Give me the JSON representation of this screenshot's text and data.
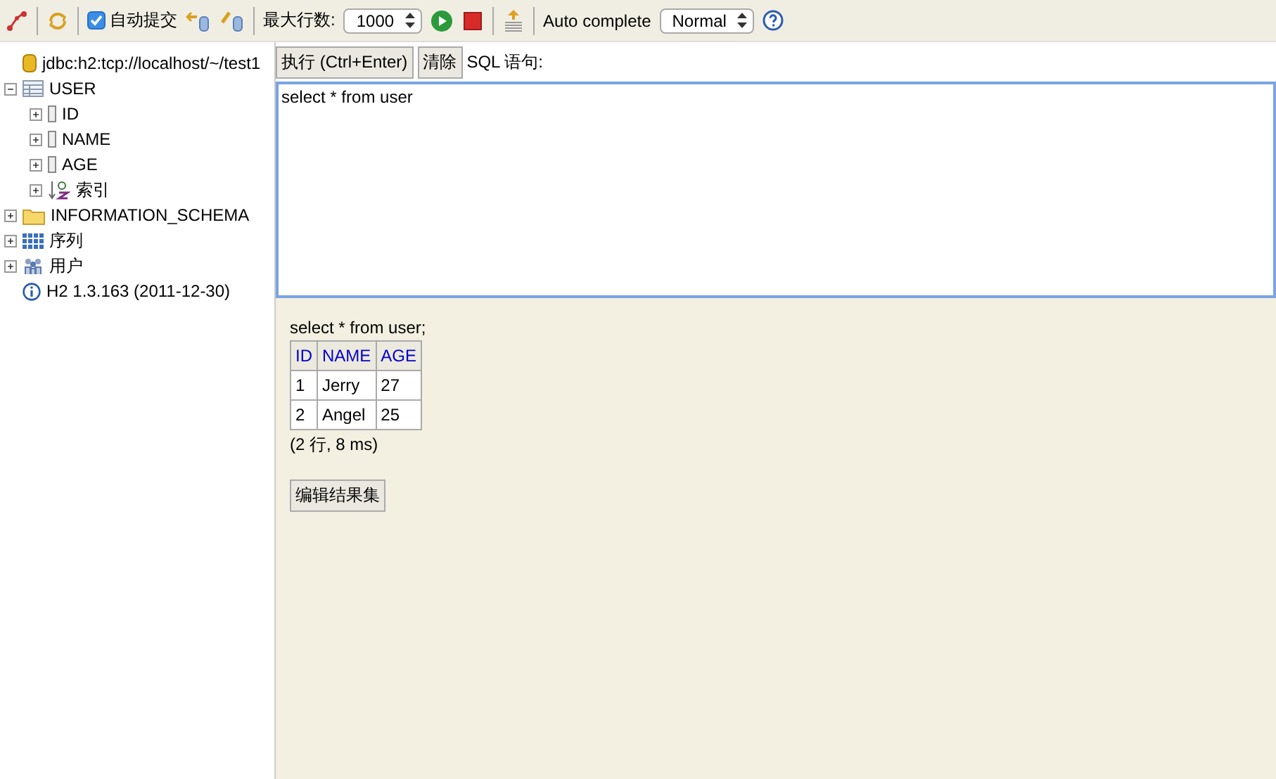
{
  "toolbar": {
    "autocommit": {
      "label": "自动提交",
      "checked": true
    },
    "max_rows": {
      "label": "最大行数:",
      "value": "1000"
    },
    "autocomplete": {
      "label": "Auto complete",
      "value": "Normal"
    }
  },
  "tree": [
    {
      "kind": "database",
      "label": "jdbc:h2:tcp://localhost/~/test1"
    },
    {
      "kind": "table",
      "label": "USER",
      "expanded": true,
      "children": [
        {
          "kind": "column",
          "label": "ID",
          "expanded": false
        },
        {
          "kind": "column",
          "label": "NAME",
          "expanded": false
        },
        {
          "kind": "column",
          "label": "AGE",
          "expanded": false
        },
        {
          "kind": "index",
          "label": "索引",
          "expanded": false
        }
      ]
    },
    {
      "kind": "folder",
      "label": "INFORMATION_SCHEMA",
      "expanded": false
    },
    {
      "kind": "sequence",
      "label": "序列",
      "expanded": false
    },
    {
      "kind": "users",
      "label": "用户",
      "expanded": false
    },
    {
      "kind": "info",
      "label": "H2 1.3.163 (2011-12-30)"
    }
  ],
  "editor": {
    "run_button": "执行 (Ctrl+Enter)",
    "clear_button": "清除",
    "label": "SQL 语句:",
    "value": "select * from user"
  },
  "result": {
    "statement": "select * from user;",
    "columns": [
      "ID",
      "NAME",
      "AGE"
    ],
    "rows": [
      [
        "1",
        "Jerry",
        "27"
      ],
      [
        "2",
        "Angel",
        "25"
      ]
    ],
    "summary": "(2 行, 8 ms)",
    "edit_button": "编辑结果集"
  }
}
